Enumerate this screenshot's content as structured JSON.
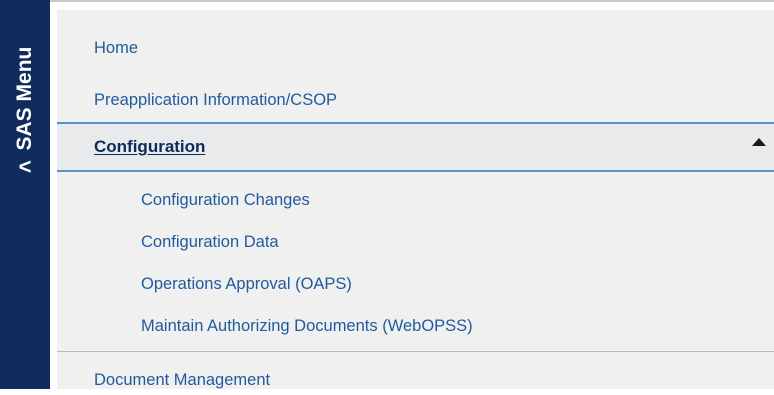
{
  "side_tab": {
    "label": "SAS Menu",
    "chevron": "<"
  },
  "menu": {
    "items": [
      {
        "label": "Home"
      },
      {
        "label": "Preapplication Information/CSOP"
      },
      {
        "label": "Configuration",
        "expanded": true,
        "indicator_icon": "triangle-up-icon",
        "subitems": [
          {
            "label": "Configuration Changes"
          },
          {
            "label": "Configuration Data"
          },
          {
            "label": "Operations Approval (OAPS)"
          },
          {
            "label": "Maintain Authorizing Documents (WebOPSS)"
          }
        ]
      },
      {
        "label": "Document Management"
      }
    ]
  },
  "colors": {
    "tab_background": "#0f2c5c",
    "link": "#1f5a9c",
    "active_text": "#0d2c5a",
    "active_border": "#5b91c9",
    "menu_background": "#f0f0f0"
  }
}
